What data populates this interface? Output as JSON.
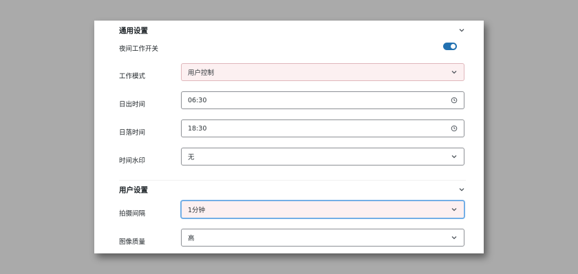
{
  "general_section": {
    "title": "通用设置",
    "night_switch": {
      "label": "夜间工作开关",
      "state": "on"
    },
    "work_mode": {
      "label": "工作模式",
      "value": "用户控制"
    },
    "sunrise": {
      "label": "日出时间",
      "value": "06:30"
    },
    "sunset": {
      "label": "日落时间",
      "value": "18:30"
    },
    "watermark": {
      "label": "时间水印",
      "value": "无"
    }
  },
  "user_section": {
    "title": "用户设置",
    "interval": {
      "label": "拍摄间隔",
      "value": "1分钟"
    },
    "quality": {
      "label": "图像质量",
      "value": "高"
    }
  },
  "colors": {
    "accent": "#2271b1",
    "warning_bg": "#fcf0f1",
    "focus_border": "#72aee6",
    "backdrop": "#aaaaaa"
  },
  "icons": {
    "collapse": "chevron-down-icon",
    "select": "chevron-down-icon",
    "time": "clock-icon"
  }
}
